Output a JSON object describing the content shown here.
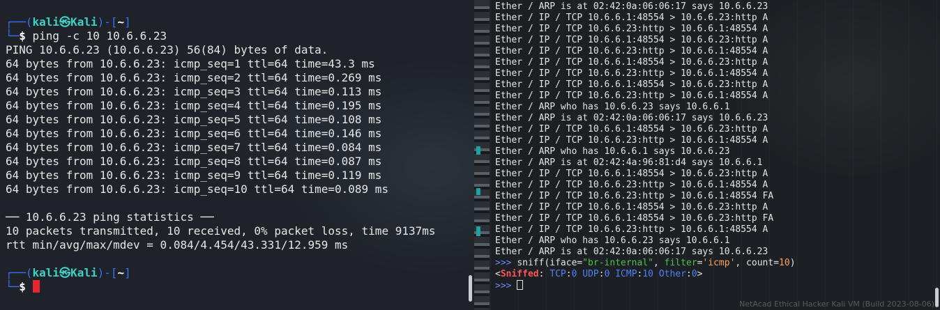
{
  "left_terminal": {
    "prompt1": {
      "user": "kali",
      "at": "㉿",
      "host": "Kali",
      "dir": "~",
      "command": "ping -c 10 10.6.6.23"
    },
    "output": [
      "PING 10.6.6.23 (10.6.6.23) 56(84) bytes of data.",
      "64 bytes from 10.6.6.23: icmp_seq=1 ttl=64 time=43.3 ms",
      "64 bytes from 10.6.6.23: icmp_seq=2 ttl=64 time=0.269 ms",
      "64 bytes from 10.6.6.23: icmp_seq=3 ttl=64 time=0.113 ms",
      "64 bytes from 10.6.6.23: icmp_seq=4 ttl=64 time=0.195 ms",
      "64 bytes from 10.6.6.23: icmp_seq=5 ttl=64 time=0.108 ms",
      "64 bytes from 10.6.6.23: icmp_seq=6 ttl=64 time=0.146 ms",
      "64 bytes from 10.6.6.23: icmp_seq=7 ttl=64 time=0.084 ms",
      "64 bytes from 10.6.6.23: icmp_seq=8 ttl=64 time=0.087 ms",
      "64 bytes from 10.6.6.23: icmp_seq=9 ttl=64 time=0.119 ms",
      "64 bytes from 10.6.6.23: icmp_seq=10 ttl=64 time=0.089 ms",
      "",
      "── 10.6.6.23 ping statistics ──",
      "10 packets transmitted, 10 received, 0% packet loss, time 9137ms",
      "rtt min/avg/max/mdev = 0.084/4.454/43.331/12.959 ms"
    ],
    "prompt2": {
      "user": "kali",
      "at": "㉿",
      "host": "Kali",
      "dir": "~"
    }
  },
  "right_terminal": {
    "lines": [
      "Ether / ARP is at 02:42:0a:06:06:17 says 10.6.6.23",
      "Ether / IP / TCP 10.6.6.1:48554 > 10.6.6.23:http A",
      "Ether / IP / TCP 10.6.6.23:http > 10.6.6.1:48554 A",
      "Ether / IP / TCP 10.6.6.1:48554 > 10.6.6.23:http A",
      "Ether / IP / TCP 10.6.6.23:http > 10.6.6.1:48554 A",
      "Ether / IP / TCP 10.6.6.1:48554 > 10.6.6.23:http A",
      "Ether / IP / TCP 10.6.6.23:http > 10.6.6.1:48554 A",
      "Ether / IP / TCP 10.6.6.1:48554 > 10.6.6.23:http A",
      "Ether / IP / TCP 10.6.6.23:http > 10.6.6.1:48554 A",
      "Ether / ARP who has 10.6.6.23 says 10.6.6.1",
      "Ether / ARP is at 02:42:0a:06:06:17 says 10.6.6.23",
      "Ether / IP / TCP 10.6.6.1:48554 > 10.6.6.23:http A",
      "Ether / IP / TCP 10.6.6.23:http > 10.6.6.1:48554 A",
      "Ether / ARP who has 10.6.6.1 says 10.6.6.23",
      "Ether / ARP is at 02:42:4a:96:81:d4 says 10.6.6.1",
      "Ether / IP / TCP 10.6.6.1:48554 > 10.6.6.23:http A",
      "Ether / IP / TCP 10.6.6.23:http > 10.6.6.1:48554 A",
      "Ether / IP / TCP 10.6.6.23:http > 10.6.6.1:48554 FA",
      "Ether / IP / TCP 10.6.6.1:48554 > 10.6.6.23:http A",
      "Ether / IP / TCP 10.6.6.1:48554 > 10.6.6.23:http FA",
      "Ether / IP / TCP 10.6.6.23:http > 10.6.6.1:48554 A",
      "Ether / ARP who has 10.6.6.23 says 10.6.6.1",
      "Ether / ARP is at 02:42:0a:06:06:17 says 10.6.6.23"
    ],
    "sniff_cmd": {
      "prompt": ">>>",
      "prefix": "sniff(iface=",
      "iface": "\"br-internal\"",
      "mid": ", ",
      "filter_kw": "filter",
      "eq": "=",
      "filter_val": "'icmp'",
      "count_part": ", count=",
      "count": "10",
      "close": ")"
    },
    "sniffed": {
      "open": "<",
      "label": "Sniffed",
      "colon": ":",
      "tcp": "TCP",
      "tcp_n": "0",
      "udp": "UDP",
      "udp_n": "0",
      "icmp": "ICMP",
      "icmp_n": "10",
      "other": "Other",
      "other_n": "0",
      "close": ">"
    },
    "final_prompt": ">>>",
    "watermark": "NetAcad Ethical Hacker Kali VM (Build 2023-08-06)"
  }
}
